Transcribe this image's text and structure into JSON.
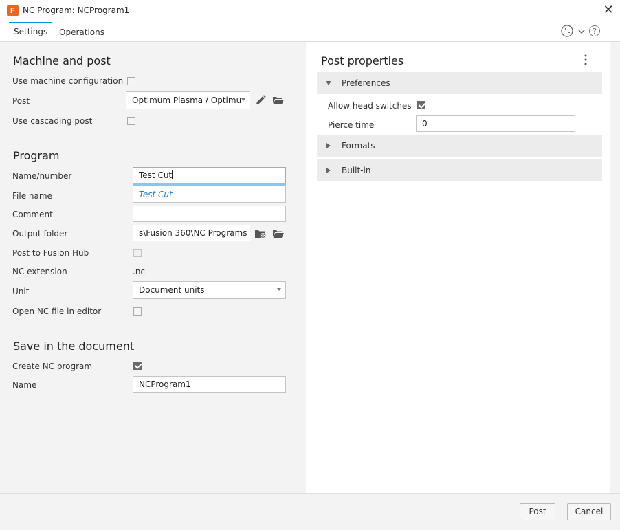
{
  "window": {
    "title": "NC Program: NCProgram1",
    "app_icon_letter": "F",
    "close_glyph": "✕"
  },
  "tabs": [
    {
      "label": "Settings"
    },
    {
      "label": "Operations"
    }
  ],
  "header_icons": {
    "help_glyph": "?"
  },
  "machine": {
    "title": "Machine and post",
    "use_machine_config_label": "Use machine configuration",
    "use_machine_config_checked": false,
    "post_label": "Post",
    "post_value": "Optimum Plasma / Optimu",
    "use_cascading_label": "Use cascading post",
    "use_cascading_checked": false
  },
  "program": {
    "title": "Program",
    "name_label": "Name/number",
    "name_value": "Test Cut",
    "autocomplete_suggestion": "Test Cut",
    "file_name_label": "File name",
    "comment_label": "Comment",
    "comment_value": "",
    "output_folder_label": "Output folder",
    "output_folder_value": "s\\Fusion 360\\NC Programs",
    "post_to_hub_label": "Post to Fusion Hub",
    "nc_extension_label": "NC extension",
    "nc_extension_value": ".nc",
    "unit_label": "Unit",
    "unit_value": "Document units",
    "open_in_editor_label": "Open NC file in editor"
  },
  "save": {
    "title": "Save in the document",
    "create_label": "Create NC program",
    "create_checked": true,
    "name_label": "Name",
    "name_value": "NCProgram1"
  },
  "post_properties": {
    "title": "Post properties",
    "sections": [
      {
        "label": "Preferences",
        "expanded": true
      },
      {
        "label": "Formats",
        "expanded": false
      },
      {
        "label": "Built-in",
        "expanded": false
      }
    ],
    "allow_head_switches_label": "Allow head switches",
    "allow_head_switches_checked": true,
    "pierce_time_label": "Pierce time",
    "pierce_time_value": "0"
  },
  "footer": {
    "post_button": "Post",
    "cancel_button": "Cancel"
  },
  "colors": {
    "accent": "#0696d7",
    "app_icon": "#e8651f",
    "suggestion_text": "#1a7fc0"
  }
}
